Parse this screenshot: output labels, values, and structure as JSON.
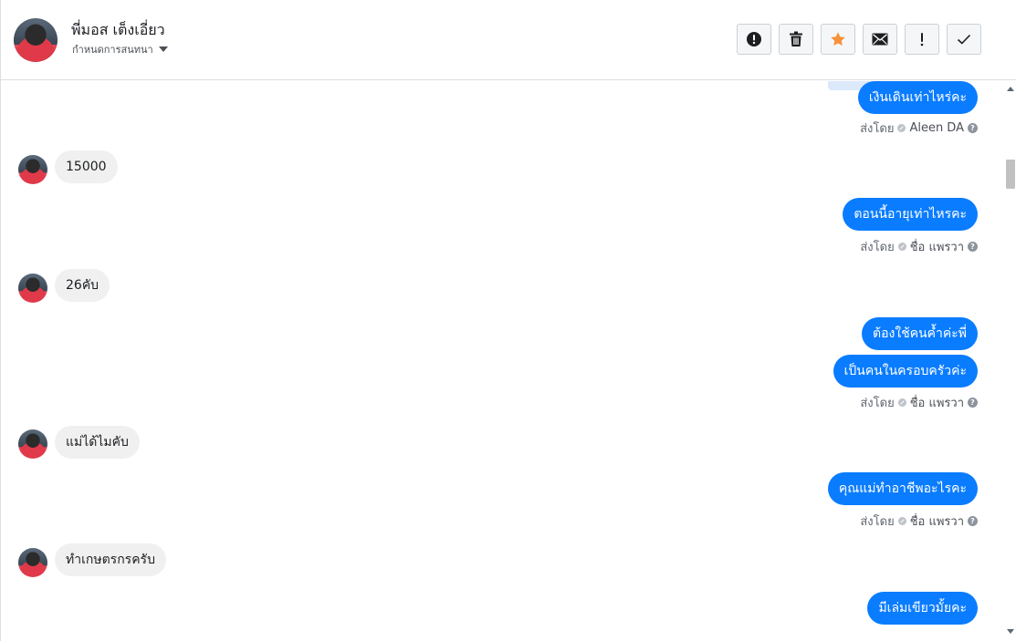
{
  "header": {
    "contact_name": "พี่มอส เต็งเอี่ยว",
    "status_label": "กำหนดการสนทนา"
  },
  "toolbar": [
    {
      "name": "spam-button",
      "icon": "alert-circle-icon"
    },
    {
      "name": "delete-button",
      "icon": "trash-icon"
    },
    {
      "name": "star-button",
      "icon": "star-icon",
      "color": "#f7923b"
    },
    {
      "name": "mark-unread-button",
      "icon": "envelope-icon"
    },
    {
      "name": "follow-up-button",
      "icon": "exclamation-icon"
    },
    {
      "name": "mark-done-button",
      "icon": "check-icon"
    }
  ],
  "messages": [
    {
      "direction": "out",
      "text": "เงินเดินเท่าไหร่คะ"
    },
    {
      "sent_by": {
        "label": "ส่งโดย",
        "agent": "Aleen DA"
      }
    },
    {
      "direction": "in",
      "text": "15000"
    },
    {
      "direction": "out",
      "text": "ตอนนี้อายุเท่าไหรคะ"
    },
    {
      "sent_by": {
        "label": "ส่งโดย",
        "agent": "ชื่อ แพรวา"
      }
    },
    {
      "direction": "in",
      "text": "26คับ"
    },
    {
      "direction": "out",
      "text": "ต้องใช้คนค้ำค่ะพี่"
    },
    {
      "direction": "out",
      "text": "เป็นคนในครอบครัวค่ะ"
    },
    {
      "sent_by": {
        "label": "ส่งโดย",
        "agent": "ชื่อ แพรวา"
      }
    },
    {
      "direction": "in",
      "text": "แม่ได้ไมคับ"
    },
    {
      "direction": "out",
      "text": "คุณแม่ทำอาชีพอะไรคะ"
    },
    {
      "sent_by": {
        "label": "ส่งโดย",
        "agent": "ชื่อ แพรวา"
      }
    },
    {
      "direction": "in",
      "text": "ทำเกษตรกรครับ"
    },
    {
      "direction": "out",
      "text": "มีเล่มเขียวมั้ยคะ"
    }
  ],
  "colors": {
    "outgoing_bubble": "#0a7cff",
    "incoming_bubble": "#f0f0f0",
    "star_accent": "#f7923b"
  }
}
